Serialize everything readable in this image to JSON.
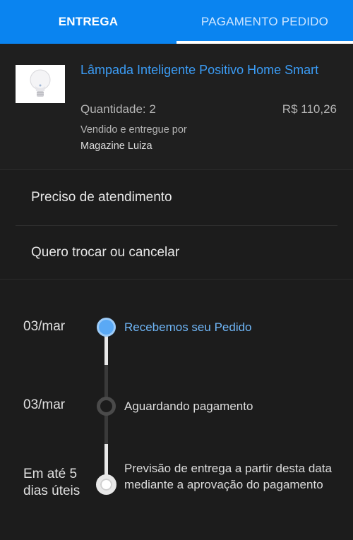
{
  "tabs": [
    {
      "label": "ENTREGA",
      "active": true
    },
    {
      "label": "PAGAMENTO PEDIDO",
      "active": false
    }
  ],
  "product": {
    "name": "Lâmpada Inteligente Positivo Home Smart",
    "quantity": "Quantidade: 2",
    "price": "R$ 110,26",
    "sold_by_label": "Vendido e entregue por",
    "seller": "Magazine Luiza",
    "thumbnail_icon": "light-bulb-icon"
  },
  "actions": [
    {
      "label": "Preciso de atendimento"
    },
    {
      "label": "Quero trocar ou cancelar"
    }
  ],
  "timeline": [
    {
      "date": "03/mar",
      "label": "Recebemos seu Pedido",
      "state": "done"
    },
    {
      "date": "03/mar",
      "label": "Aguardando pagamento",
      "state": "current"
    },
    {
      "date": "Em até 5 dias úteis",
      "label": "Previsão de entrega a partir desta data mediante a aprovação do pagamento",
      "state": "pending"
    }
  ],
  "colors": {
    "brand": "#0a84f0",
    "link": "#3b9cf5",
    "done_dot": "#5aa9f5",
    "background": "#1c1c1c"
  }
}
